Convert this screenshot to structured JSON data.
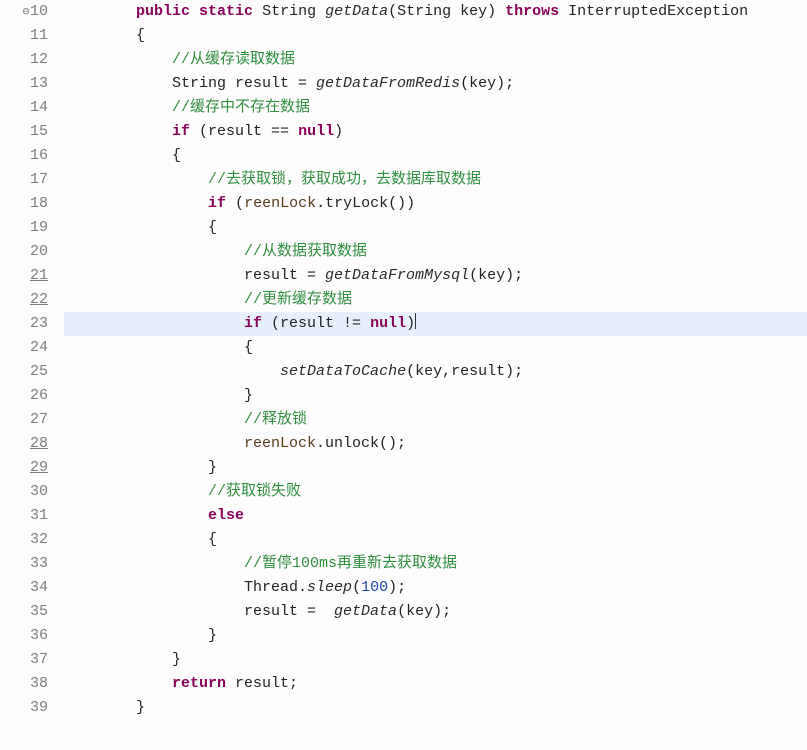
{
  "lineNumbers": [
    "10",
    "11",
    "12",
    "13",
    "14",
    "15",
    "16",
    "17",
    "18",
    "19",
    "20",
    "21",
    "22",
    "23",
    "24",
    "25",
    "26",
    "27",
    "28",
    "29",
    "30",
    "31",
    "32",
    "33",
    "34",
    "35",
    "36",
    "37",
    "38",
    "39"
  ],
  "underlineLines": [
    "21",
    "22",
    "28",
    "29"
  ],
  "highlightLine": "23",
  "indentUnit": "    ",
  "code": {
    "l10": {
      "indent": 2,
      "tokens": [
        {
          "t": "public",
          "c": "kw"
        },
        {
          "t": " "
        },
        {
          "t": "static",
          "c": "kw"
        },
        {
          "t": " String "
        },
        {
          "t": "getData",
          "c": "fn"
        },
        {
          "t": "(String key) "
        },
        {
          "t": "throws",
          "c": "kw"
        },
        {
          "t": " InterruptedException"
        }
      ]
    },
    "l11": {
      "indent": 2,
      "tokens": [
        {
          "t": "{"
        }
      ]
    },
    "l12": {
      "indent": 3,
      "tokens": [
        {
          "t": "//从缓存读取数据",
          "c": "cmt"
        }
      ]
    },
    "l13": {
      "indent": 3,
      "tokens": [
        {
          "t": "String result = "
        },
        {
          "t": "getDataFromRedis",
          "c": "fn"
        },
        {
          "t": "(key);"
        }
      ]
    },
    "l14": {
      "indent": 3,
      "tokens": [
        {
          "t": "//缓存中不存在数据",
          "c": "cmt"
        }
      ]
    },
    "l15": {
      "indent": 3,
      "tokens": [
        {
          "t": "if",
          "c": "kw"
        },
        {
          "t": " (result == "
        },
        {
          "t": "null",
          "c": "kw"
        },
        {
          "t": ")"
        }
      ]
    },
    "l16": {
      "indent": 3,
      "tokens": [
        {
          "t": "{"
        }
      ]
    },
    "l17": {
      "indent": 4,
      "tokens": [
        {
          "t": "//去获取锁，获取成功，去数据库取数据",
          "c": "cmt"
        }
      ]
    },
    "l18": {
      "indent": 4,
      "tokens": [
        {
          "t": "if",
          "c": "kw"
        },
        {
          "t": " ("
        },
        {
          "t": "reenLock",
          "c": "var"
        },
        {
          "t": ".tryLock())"
        }
      ]
    },
    "l19": {
      "indent": 4,
      "tokens": [
        {
          "t": "{"
        }
      ]
    },
    "l20": {
      "indent": 5,
      "tokens": [
        {
          "t": "//从数据获取数据",
          "c": "cmt"
        }
      ]
    },
    "l21": {
      "indent": 5,
      "tokens": [
        {
          "t": "result = "
        },
        {
          "t": "getDataFromMysql",
          "c": "fn"
        },
        {
          "t": "(key);"
        }
      ]
    },
    "l22": {
      "indent": 5,
      "tokens": [
        {
          "t": "//更新缓存数据",
          "c": "cmt"
        }
      ]
    },
    "l23": {
      "indent": 5,
      "tokens": [
        {
          "t": "if",
          "c": "kw"
        },
        {
          "t": " (result != "
        },
        {
          "t": "null",
          "c": "kw"
        },
        {
          "t": ")"
        }
      ],
      "caret": true
    },
    "l24": {
      "indent": 5,
      "tokens": [
        {
          "t": "{"
        }
      ]
    },
    "l25": {
      "indent": 6,
      "tokens": [
        {
          "t": "setDataToCache",
          "c": "fn"
        },
        {
          "t": "(key,result);"
        }
      ]
    },
    "l26": {
      "indent": 5,
      "tokens": [
        {
          "t": "}"
        }
      ]
    },
    "l27": {
      "indent": 5,
      "tokens": [
        {
          "t": "//释放锁",
          "c": "cmt"
        }
      ]
    },
    "l28": {
      "indent": 5,
      "tokens": [
        {
          "t": "reenLock",
          "c": "var"
        },
        {
          "t": ".unlock();"
        }
      ]
    },
    "l29": {
      "indent": 4,
      "tokens": [
        {
          "t": "}"
        }
      ]
    },
    "l30": {
      "indent": 4,
      "tokens": [
        {
          "t": "//获取锁失败",
          "c": "cmt"
        }
      ]
    },
    "l31": {
      "indent": 4,
      "tokens": [
        {
          "t": "else",
          "c": "kw"
        }
      ]
    },
    "l32": {
      "indent": 4,
      "tokens": [
        {
          "t": "{"
        }
      ]
    },
    "l33": {
      "indent": 5,
      "tokens": [
        {
          "t": "//暂停100ms再重新去获取数据",
          "c": "cmt"
        }
      ]
    },
    "l34": {
      "indent": 5,
      "tokens": [
        {
          "t": "Thread."
        },
        {
          "t": "sleep",
          "c": "fn"
        },
        {
          "t": "("
        },
        {
          "t": "100",
          "c": "num"
        },
        {
          "t": ");"
        }
      ]
    },
    "l35": {
      "indent": 5,
      "tokens": [
        {
          "t": "result =  "
        },
        {
          "t": "getData",
          "c": "fn"
        },
        {
          "t": "(key);"
        }
      ]
    },
    "l36": {
      "indent": 4,
      "tokens": [
        {
          "t": "}"
        }
      ]
    },
    "l37": {
      "indent": 3,
      "tokens": [
        {
          "t": "}"
        }
      ]
    },
    "l38": {
      "indent": 3,
      "tokens": [
        {
          "t": "return",
          "c": "kw"
        },
        {
          "t": " result;"
        }
      ]
    },
    "l39": {
      "indent": 2,
      "tokens": [
        {
          "t": "}"
        }
      ]
    }
  },
  "overrideMarkerLine": "10"
}
